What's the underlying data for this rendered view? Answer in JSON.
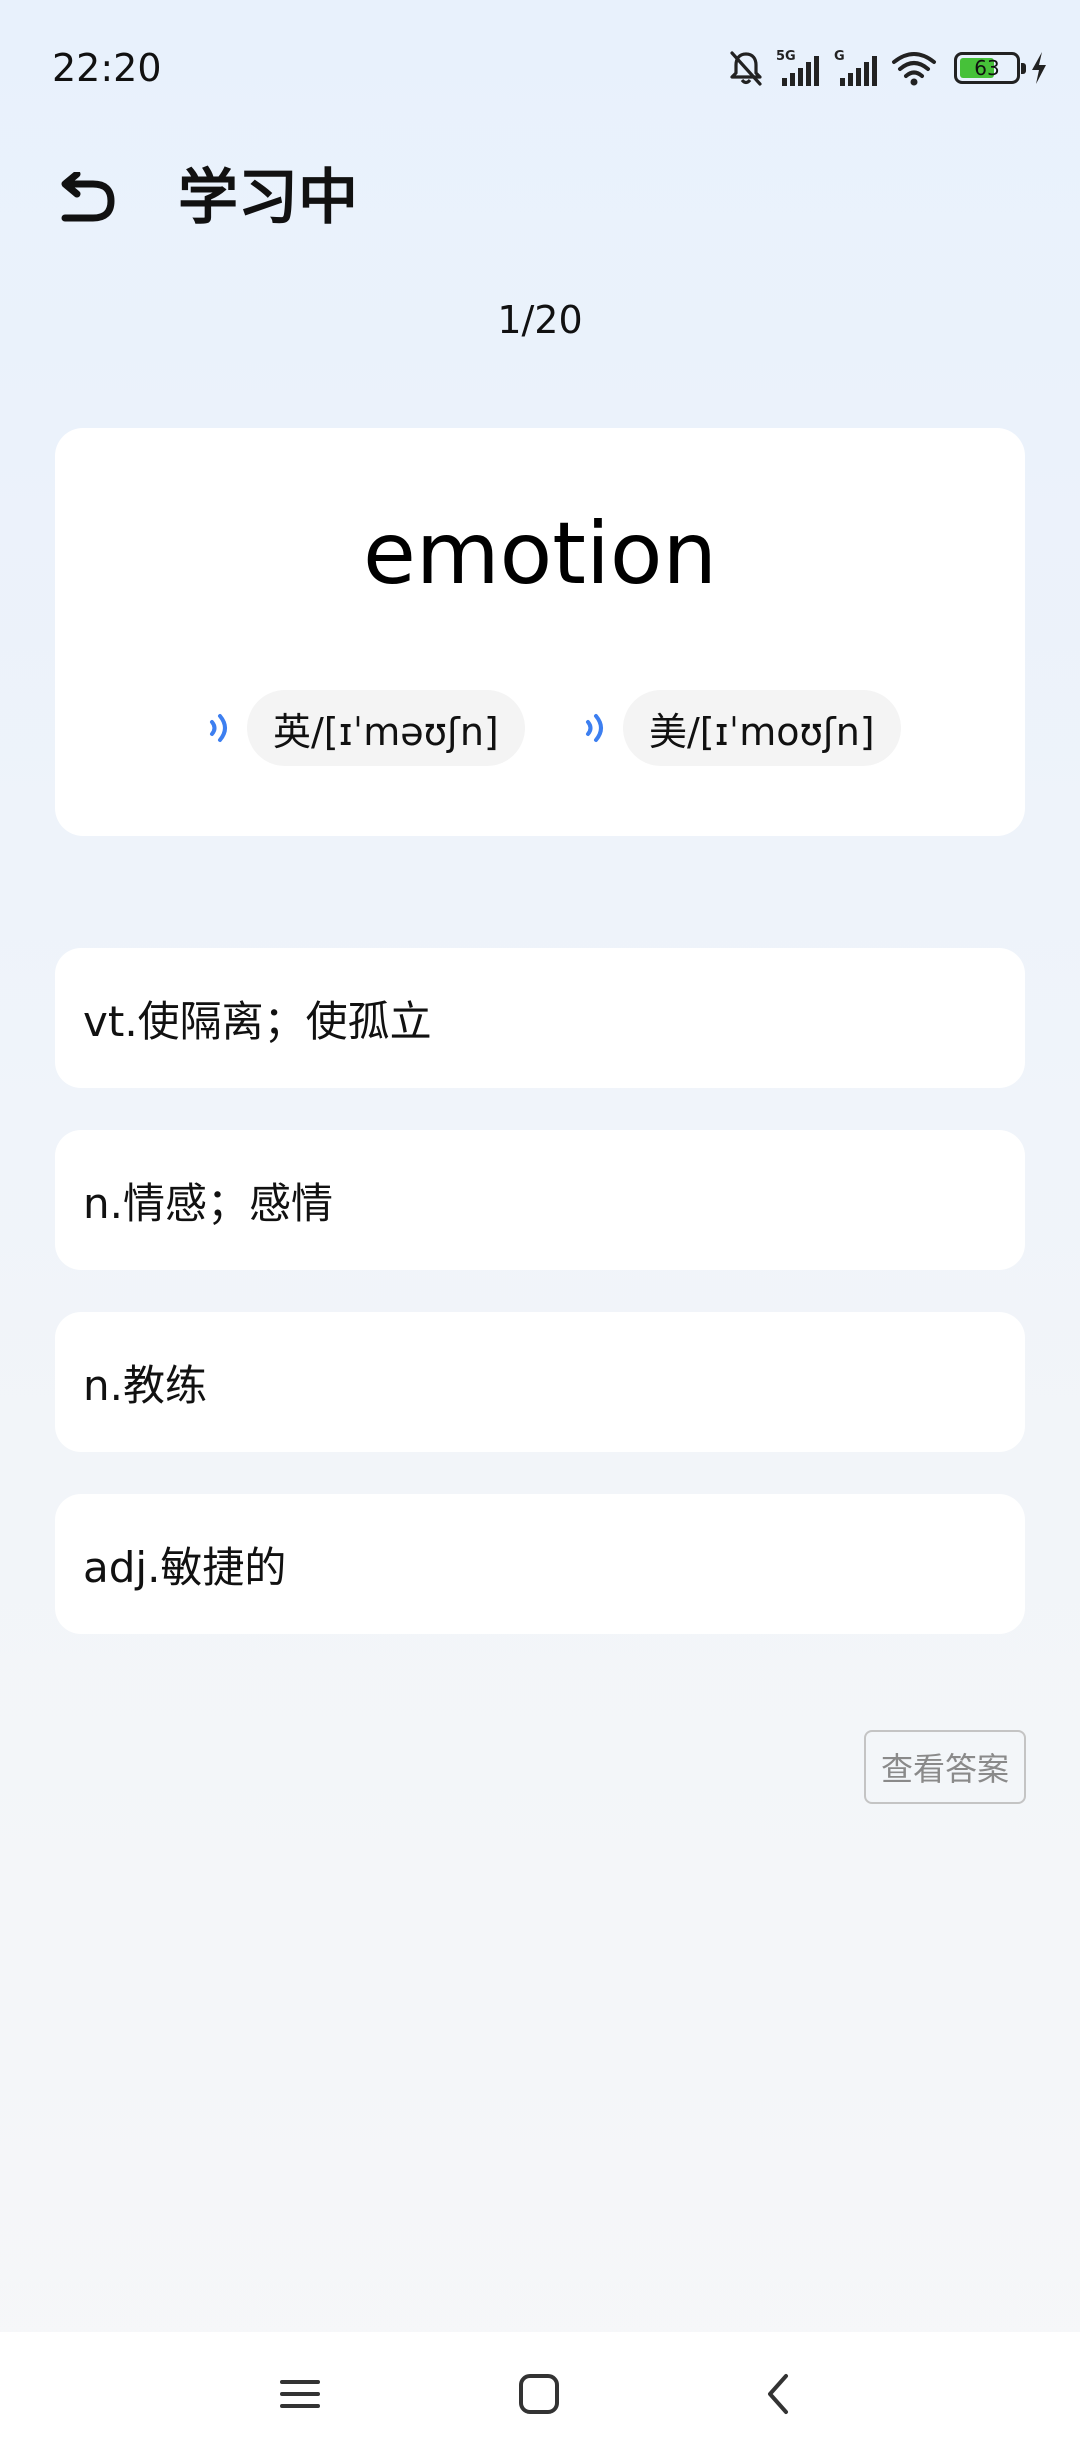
{
  "status_bar": {
    "time": "22:20",
    "network_1": "5G",
    "network_2": "G",
    "battery_level": "63",
    "battery_fraction": 0.63,
    "icons": [
      "mute-bell-icon",
      "cellular-signal-icon",
      "cellular-signal-icon",
      "wifi-icon",
      "battery-icon",
      "charging-bolt-icon"
    ]
  },
  "header": {
    "title": "学习中",
    "back_icon": "undo-arrow-icon"
  },
  "progress": {
    "text": "1/20"
  },
  "word_card": {
    "word": "emotion",
    "uk_pronunciation": "英/[ɪˈməʊʃn]",
    "us_pronunciation": "美/[ɪˈmoʊʃn]",
    "speaker_icon": "speaker-icon",
    "accent_color": "#3d7ff0"
  },
  "options": [
    {
      "text": "vt.使隔离；使孤立"
    },
    {
      "text": "n.情感；感情"
    },
    {
      "text": "n.教练"
    },
    {
      "text": "adj.敏捷的"
    }
  ],
  "answer_button": {
    "label": "查看答案"
  },
  "nav_bar": {
    "icons": [
      "menu-icon",
      "home-icon",
      "back-icon"
    ]
  }
}
